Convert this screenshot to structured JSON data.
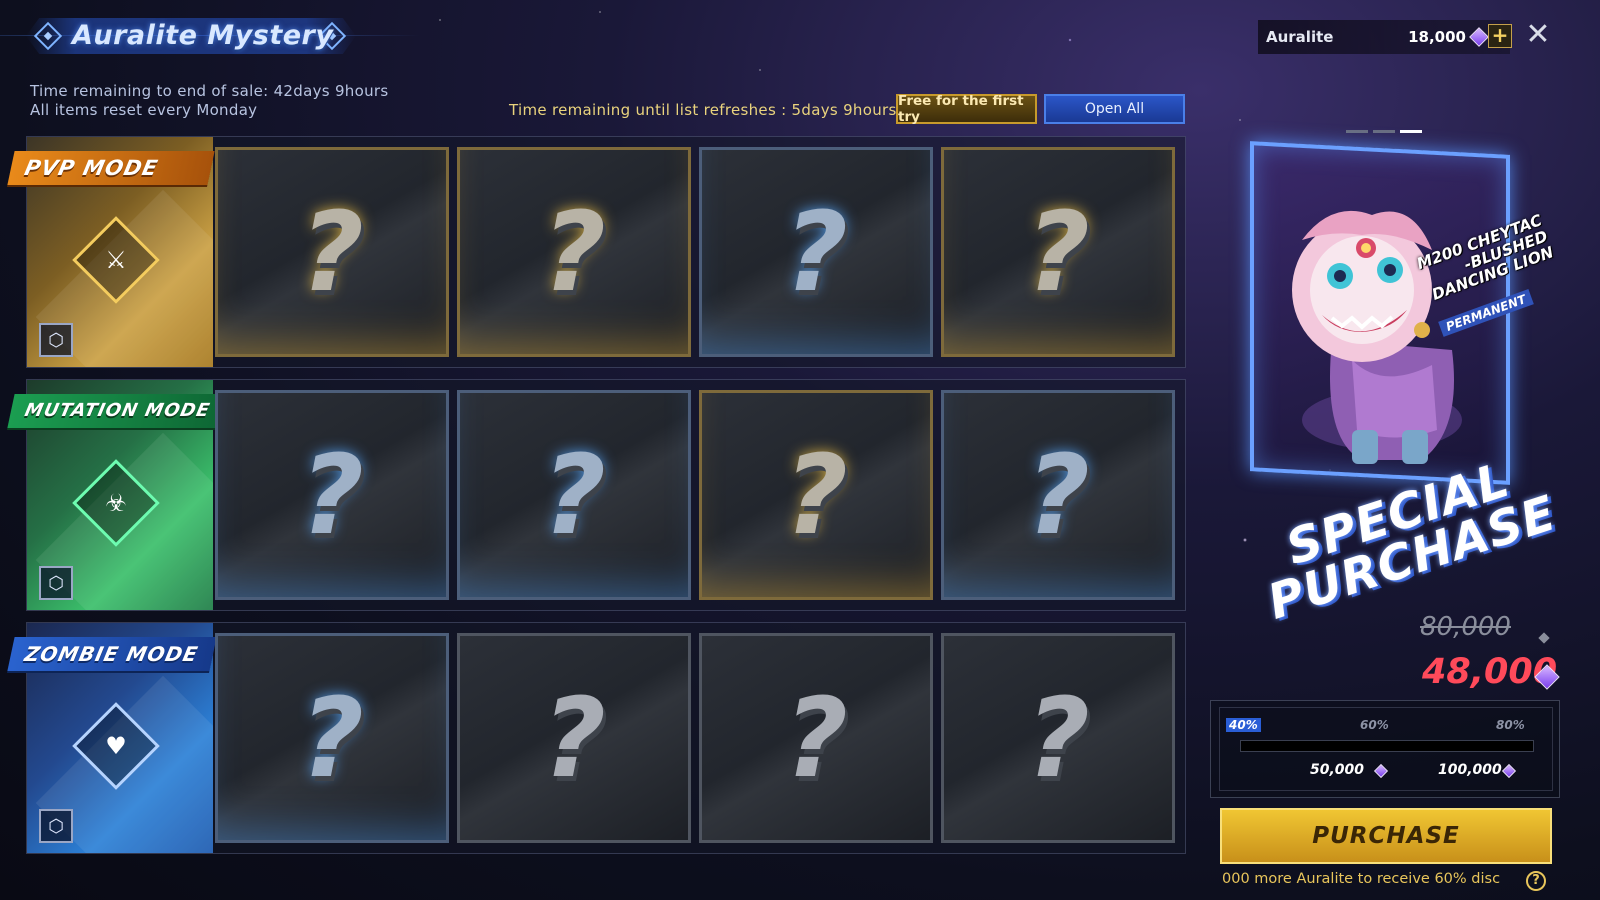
{
  "header": {
    "title": "Auralite  Mystery",
    "sale_time": "Time remaining to end of sale: 42days 9hours",
    "reset_note": "All items reset every Monday",
    "refresh_time": "Time remaining until list refreshes : 5days 9hours",
    "free_button": "Free for the first try",
    "open_all_button": "Open All"
  },
  "modes": [
    {
      "label": "PVP MODE",
      "emblem_icon": "pvp-emblem-icon",
      "accent": "#e98a1a",
      "cards": [
        {
          "symbol": "?",
          "glow": "gold"
        },
        {
          "symbol": "?",
          "glow": "gold"
        },
        {
          "symbol": "?",
          "glow": "blue"
        },
        {
          "symbol": "?",
          "glow": "gold"
        }
      ]
    },
    {
      "label": "MUTATION MODE",
      "emblem_icon": "mutation-emblem-icon",
      "accent": "#1b9e51",
      "cards": [
        {
          "symbol": "?",
          "glow": "blue"
        },
        {
          "symbol": "?",
          "glow": "blue"
        },
        {
          "symbol": "?",
          "glow": "gold"
        },
        {
          "symbol": "?",
          "glow": "blue"
        }
      ]
    },
    {
      "label": "ZOMBIE MODE",
      "emblem_icon": "zombie-emblem-icon",
      "accent": "#2a63cf",
      "cards": [
        {
          "symbol": "?",
          "glow": "blue"
        },
        {
          "symbol": "?",
          "glow": "grey"
        },
        {
          "symbol": "?",
          "glow": "grey"
        },
        {
          "symbol": "?",
          "glow": "grey"
        }
      ]
    }
  ],
  "currency": {
    "label": "Auralite",
    "value": "18,000",
    "icon": "auralite-gem-icon",
    "add_button": "+",
    "close_button": "✕"
  },
  "promo": {
    "pages": 3,
    "active_page": 3,
    "item_name_line1": "M200 CHEYTAC",
    "item_name_line2": "-BLUSHED",
    "item_name_line3": "DANCING LION",
    "item_badge": "PERMANENT",
    "banner_line1": "SPECIAL",
    "banner_line2": "PURCHASE",
    "price_original": "80,000",
    "price_discounted": "48,000",
    "price_color": "#ff4a5a"
  },
  "discount": {
    "tiers": [
      {
        "label": "40%",
        "active": true,
        "amount": ""
      },
      {
        "label": "60%",
        "active": false,
        "amount": "50,000"
      },
      {
        "label": "80%",
        "active": false,
        "amount": "100,000"
      }
    ]
  },
  "purchase": {
    "button": "PURCHASE",
    "hint": "000 more Auralite to receive 60% disc",
    "help_icon": "?"
  }
}
